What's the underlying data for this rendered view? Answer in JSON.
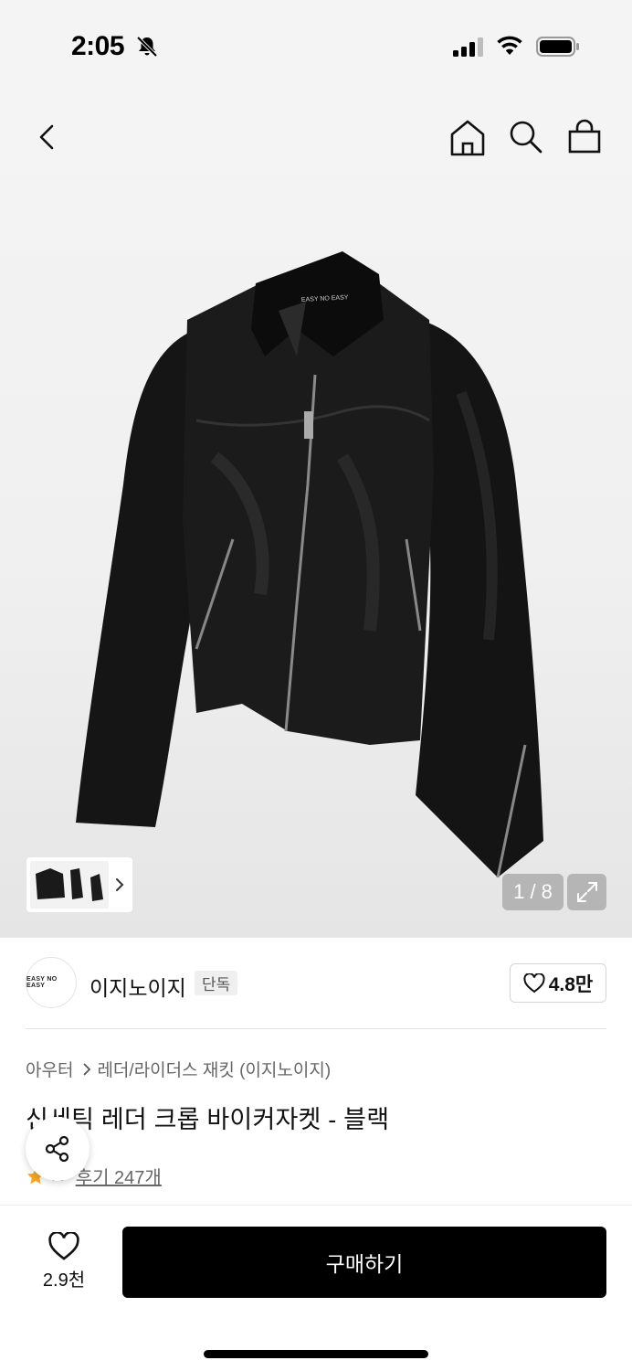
{
  "status_bar": {
    "time": "2:05",
    "icons": [
      "bell-slash-icon",
      "signal-icon",
      "wifi-icon",
      "battery-icon"
    ]
  },
  "nav": {
    "icons": [
      "back-icon",
      "home-icon",
      "search-icon",
      "shopping-bag-icon"
    ]
  },
  "gallery": {
    "counter": "1 / 8",
    "image_label": "EASY NO EASY"
  },
  "brand": {
    "logo_text": "EASY NO EASY",
    "name": "이지노이지",
    "badge": "단독",
    "likes": "4.8만"
  },
  "product": {
    "breadcrumb": [
      "아우터",
      "레더/라이더스 재킷 (이지노이지)"
    ],
    "title": "신세틱 레더 크롭 바이커자켓 - 블랙",
    "rating": ".8",
    "review_link": "후기 247개"
  },
  "bottom_bar": {
    "wish_count": "2.9천",
    "buy_label": "구매하기"
  },
  "colors": {
    "accent": "#000000",
    "star": "#f5a623",
    "hero_bg": "#f0f0f0"
  }
}
